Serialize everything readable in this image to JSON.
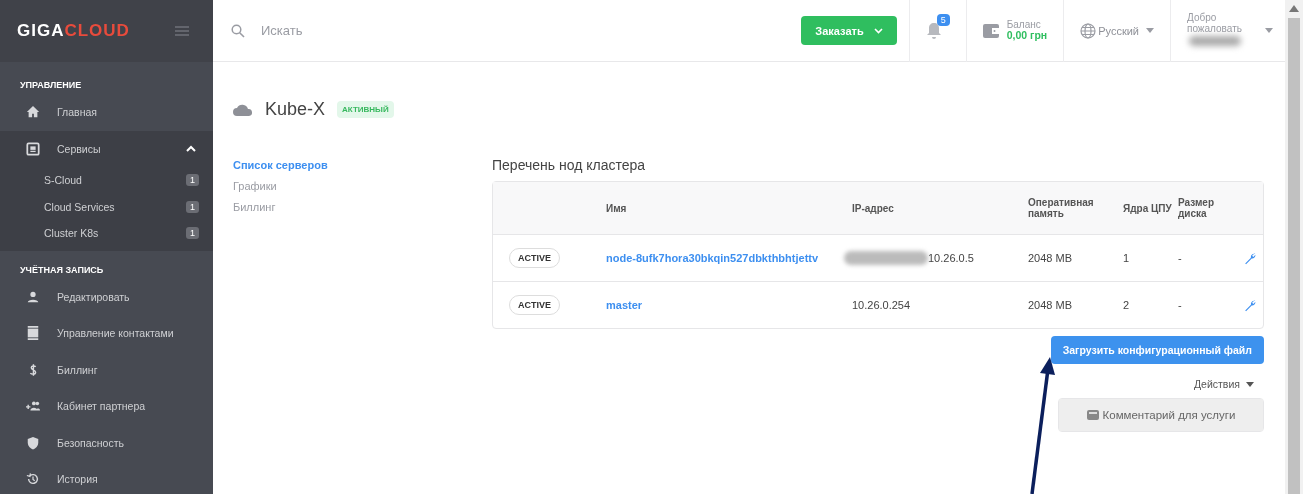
{
  "sidebar": {
    "logo": {
      "part_1": "GIGA",
      "part_2": "CLOUD"
    },
    "items": [
      {
        "kind": "header",
        "label": "УПРАВЛЕНИЕ"
      },
      {
        "kind": "item",
        "label": "Главная"
      },
      {
        "kind": "group",
        "label": "Сервисы",
        "expanded": true,
        "children": [
          {
            "label": "S-Cloud",
            "count": "1"
          },
          {
            "label": "Cloud Services",
            "count": "1"
          },
          {
            "label": "Cluster K8s",
            "count": "1"
          }
        ]
      },
      {
        "kind": "header",
        "label": "УЧЁТНАЯ ЗАПИСЬ"
      },
      {
        "kind": "item",
        "label": "Редактировать"
      },
      {
        "kind": "item",
        "label": "Управление контактами"
      },
      {
        "kind": "item",
        "label": "Биллинг"
      },
      {
        "kind": "item",
        "label": "Кабинет партнера"
      },
      {
        "kind": "item",
        "label": "Безопасность"
      },
      {
        "kind": "item",
        "label": "История"
      }
    ]
  },
  "topbar": {
    "search": {
      "placeholder": "Искать"
    },
    "order_button": "Заказать",
    "notifications": "5",
    "balance": {
      "label": "Баланс",
      "value": "0,00 грн"
    },
    "language": "Русский",
    "user": {
      "greeting": "Добро пожаловать"
    }
  },
  "service": {
    "title": "Kube-X",
    "status": "АКТИВНЫЙ"
  },
  "subnav": [
    {
      "label": "Список серверов",
      "selected": true
    },
    {
      "label": "Графики",
      "selected": false
    },
    {
      "label": "Биллинг",
      "selected": false
    }
  ],
  "table": {
    "title": "Перечень нод кластера",
    "columns": [
      "Имя",
      "IP-адрес",
      "Оперативная память",
      "Ядра ЦПУ",
      "Размер диска"
    ],
    "rows": [
      {
        "status": "ACTIVE",
        "name": "node-8ufk7hora30bkqin527dbkthbhtjettv",
        "ip": "10.26.0.5",
        "ip_redacted": true,
        "memory": "2048 MB",
        "cores": "1",
        "disk": "-"
      },
      {
        "status": "ACTIVE",
        "name": "master",
        "ip": "10.26.0.254",
        "ip_redacted": false,
        "memory": "2048 MB",
        "cores": "2",
        "disk": "-"
      }
    ]
  },
  "upload_button": "Загрузить конфигурационный файл",
  "actions": {
    "label": "Действия",
    "items": [
      "Комментарий для услуги"
    ]
  }
}
